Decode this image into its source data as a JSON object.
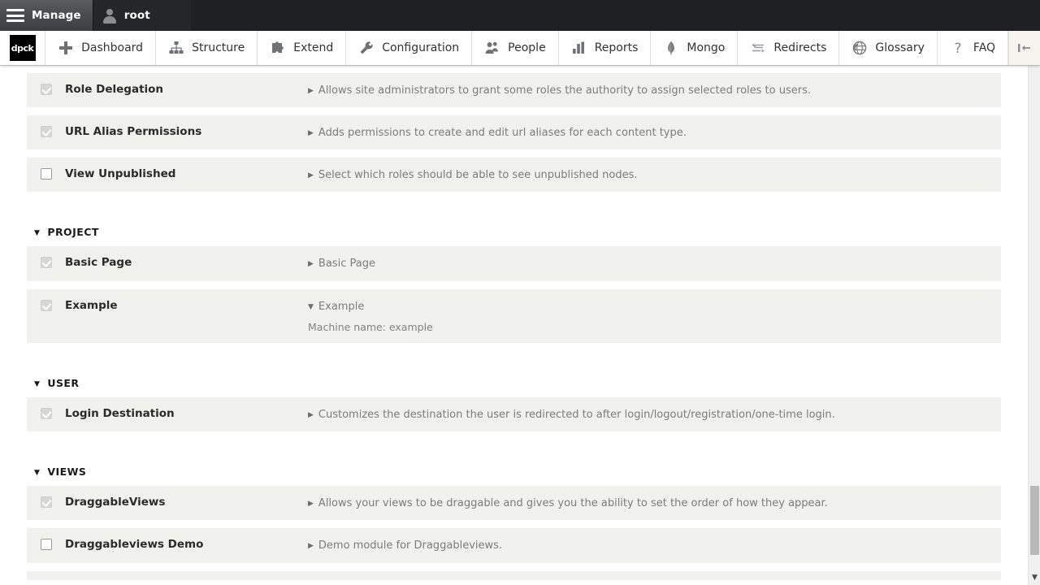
{
  "adminbar": {
    "manage_label": "Manage",
    "manage_icon": "hamburger-menu-icon",
    "user_label": "root",
    "user_icon": "person-icon"
  },
  "toolbar": {
    "logo_text": "dpck",
    "collapse_icon": "collapse-left-icon",
    "items": [
      {
        "label": "Dashboard",
        "icon": "plus-icon"
      },
      {
        "label": "Structure",
        "icon": "sitemap-icon"
      },
      {
        "label": "Extend",
        "icon": "puzzle-piece-icon"
      },
      {
        "label": "Configuration",
        "icon": "wrench-icon"
      },
      {
        "label": "People",
        "icon": "people-icon"
      },
      {
        "label": "Reports",
        "icon": "bar-chart-icon"
      },
      {
        "label": "Mongo",
        "icon": "leaf-icon"
      },
      {
        "label": "Redirects",
        "icon": "swap-arrows-icon"
      },
      {
        "label": "Glossary",
        "icon": "globe-icon"
      },
      {
        "label": "FAQ",
        "icon": "question-mark-icon"
      }
    ]
  },
  "modules": {
    "top_rows": [
      {
        "name": "Role Delegation",
        "description": "Allows site administrators to grant some roles the authority to assign selected roles to users.",
        "checked": true,
        "disabled": true,
        "expanded": false,
        "caret": "▶"
      },
      {
        "name": "URL Alias Permissions",
        "description": "Adds permissions to create and edit url aliases for each content type.",
        "checked": true,
        "disabled": true,
        "expanded": false,
        "caret": "▶"
      },
      {
        "name": "View Unpublished",
        "description": "Select which roles should be able to see unpublished nodes.",
        "checked": false,
        "disabled": false,
        "expanded": false,
        "caret": "▶"
      }
    ],
    "sections": [
      {
        "title": "PROJECT",
        "caret": "▼",
        "rows": [
          {
            "name": "Basic Page",
            "description": "Basic Page",
            "checked": true,
            "disabled": true,
            "expanded": false,
            "caret": "▶",
            "detail": ""
          },
          {
            "name": "Example",
            "description": "Example",
            "checked": true,
            "disabled": true,
            "expanded": true,
            "caret": "▼",
            "detail": "Machine name: example"
          }
        ]
      },
      {
        "title": "USER",
        "caret": "▼",
        "rows": [
          {
            "name": "Login Destination",
            "description": "Customizes the destination the user is redirected to after login/logout/registration/one-time login.",
            "checked": true,
            "disabled": true,
            "expanded": false,
            "caret": "▶",
            "detail": ""
          }
        ]
      },
      {
        "title": "VIEWS",
        "caret": "▼",
        "rows": [
          {
            "name": "DraggableViews",
            "description": "Allows your views to be draggable and gives you the ability to set the order of how they appear.",
            "checked": true,
            "disabled": true,
            "expanded": false,
            "caret": "▶",
            "detail": ""
          },
          {
            "name": "Draggableviews Demo",
            "description": "Demo module for Draggableviews.",
            "checked": false,
            "disabled": false,
            "expanded": false,
            "caret": "▶",
            "detail": ""
          }
        ]
      }
    ]
  },
  "scrollbar": {
    "down_arrow_icon": "▼"
  },
  "colors": {
    "adminbar_bg": "#1e2023",
    "row_bg": "#f1f2ed",
    "text": "#333333",
    "muted": "#7c7c78",
    "collapse_bg": "#f7f4ef"
  }
}
